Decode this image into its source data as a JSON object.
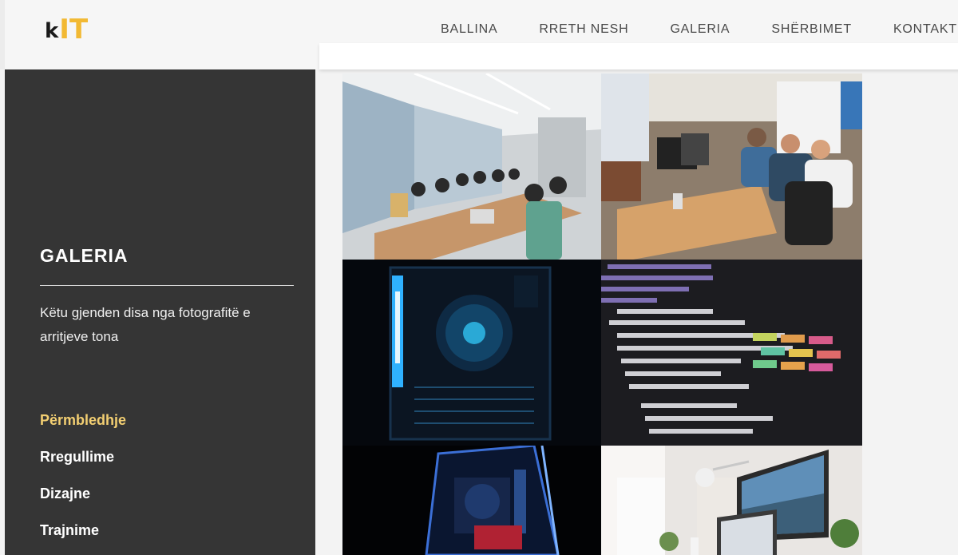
{
  "header": {
    "logo": {
      "k": "k",
      "it": "IT"
    },
    "nav": [
      "BALLINA",
      "RRETH NESH",
      "GALERIA",
      "SHËRBIMET",
      "KONTAKTI"
    ]
  },
  "sidebar": {
    "title": "GALERIA",
    "description": "Këtu gjenden disa nga fotografitë e arritjeve tona",
    "menu": [
      {
        "label": "Përmbledhje",
        "active": true
      },
      {
        "label": "Rregullime",
        "active": false
      },
      {
        "label": "Dizajne",
        "active": false
      },
      {
        "label": "Trajnime",
        "active": false
      }
    ]
  },
  "gallery": {
    "images": [
      "conference-room-photo",
      "open-office-photo",
      "pc-cpu-cooler-photo",
      "css-code-screen-photo",
      "gaming-pc-case-photo",
      "desk-monitor-laptop-photo"
    ]
  },
  "colors": {
    "accent": "#f2b933",
    "sidebar_bg": "#353535",
    "active_menu": "#f3cf72"
  }
}
